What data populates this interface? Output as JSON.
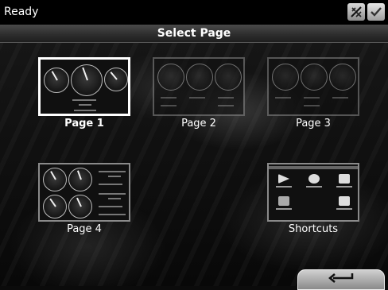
{
  "status": {
    "text": "Ready"
  },
  "header": {
    "title": "Select Page"
  },
  "icons": {
    "gps": "satellite-off-icon",
    "status": "checkmark-icon",
    "back": "back-arrow-icon"
  },
  "tiles": [
    {
      "label": "Page 1",
      "selected": true
    },
    {
      "label": "Page 2",
      "selected": false
    },
    {
      "label": "Page 3",
      "selected": false
    },
    {
      "label": "Page 4",
      "selected": false
    },
    {
      "label": "Shortcuts",
      "selected": false
    }
  ],
  "colors": {
    "selected_border": "#ffffff",
    "title_bar": "#3a3a3a",
    "status_bar": "#000000"
  }
}
